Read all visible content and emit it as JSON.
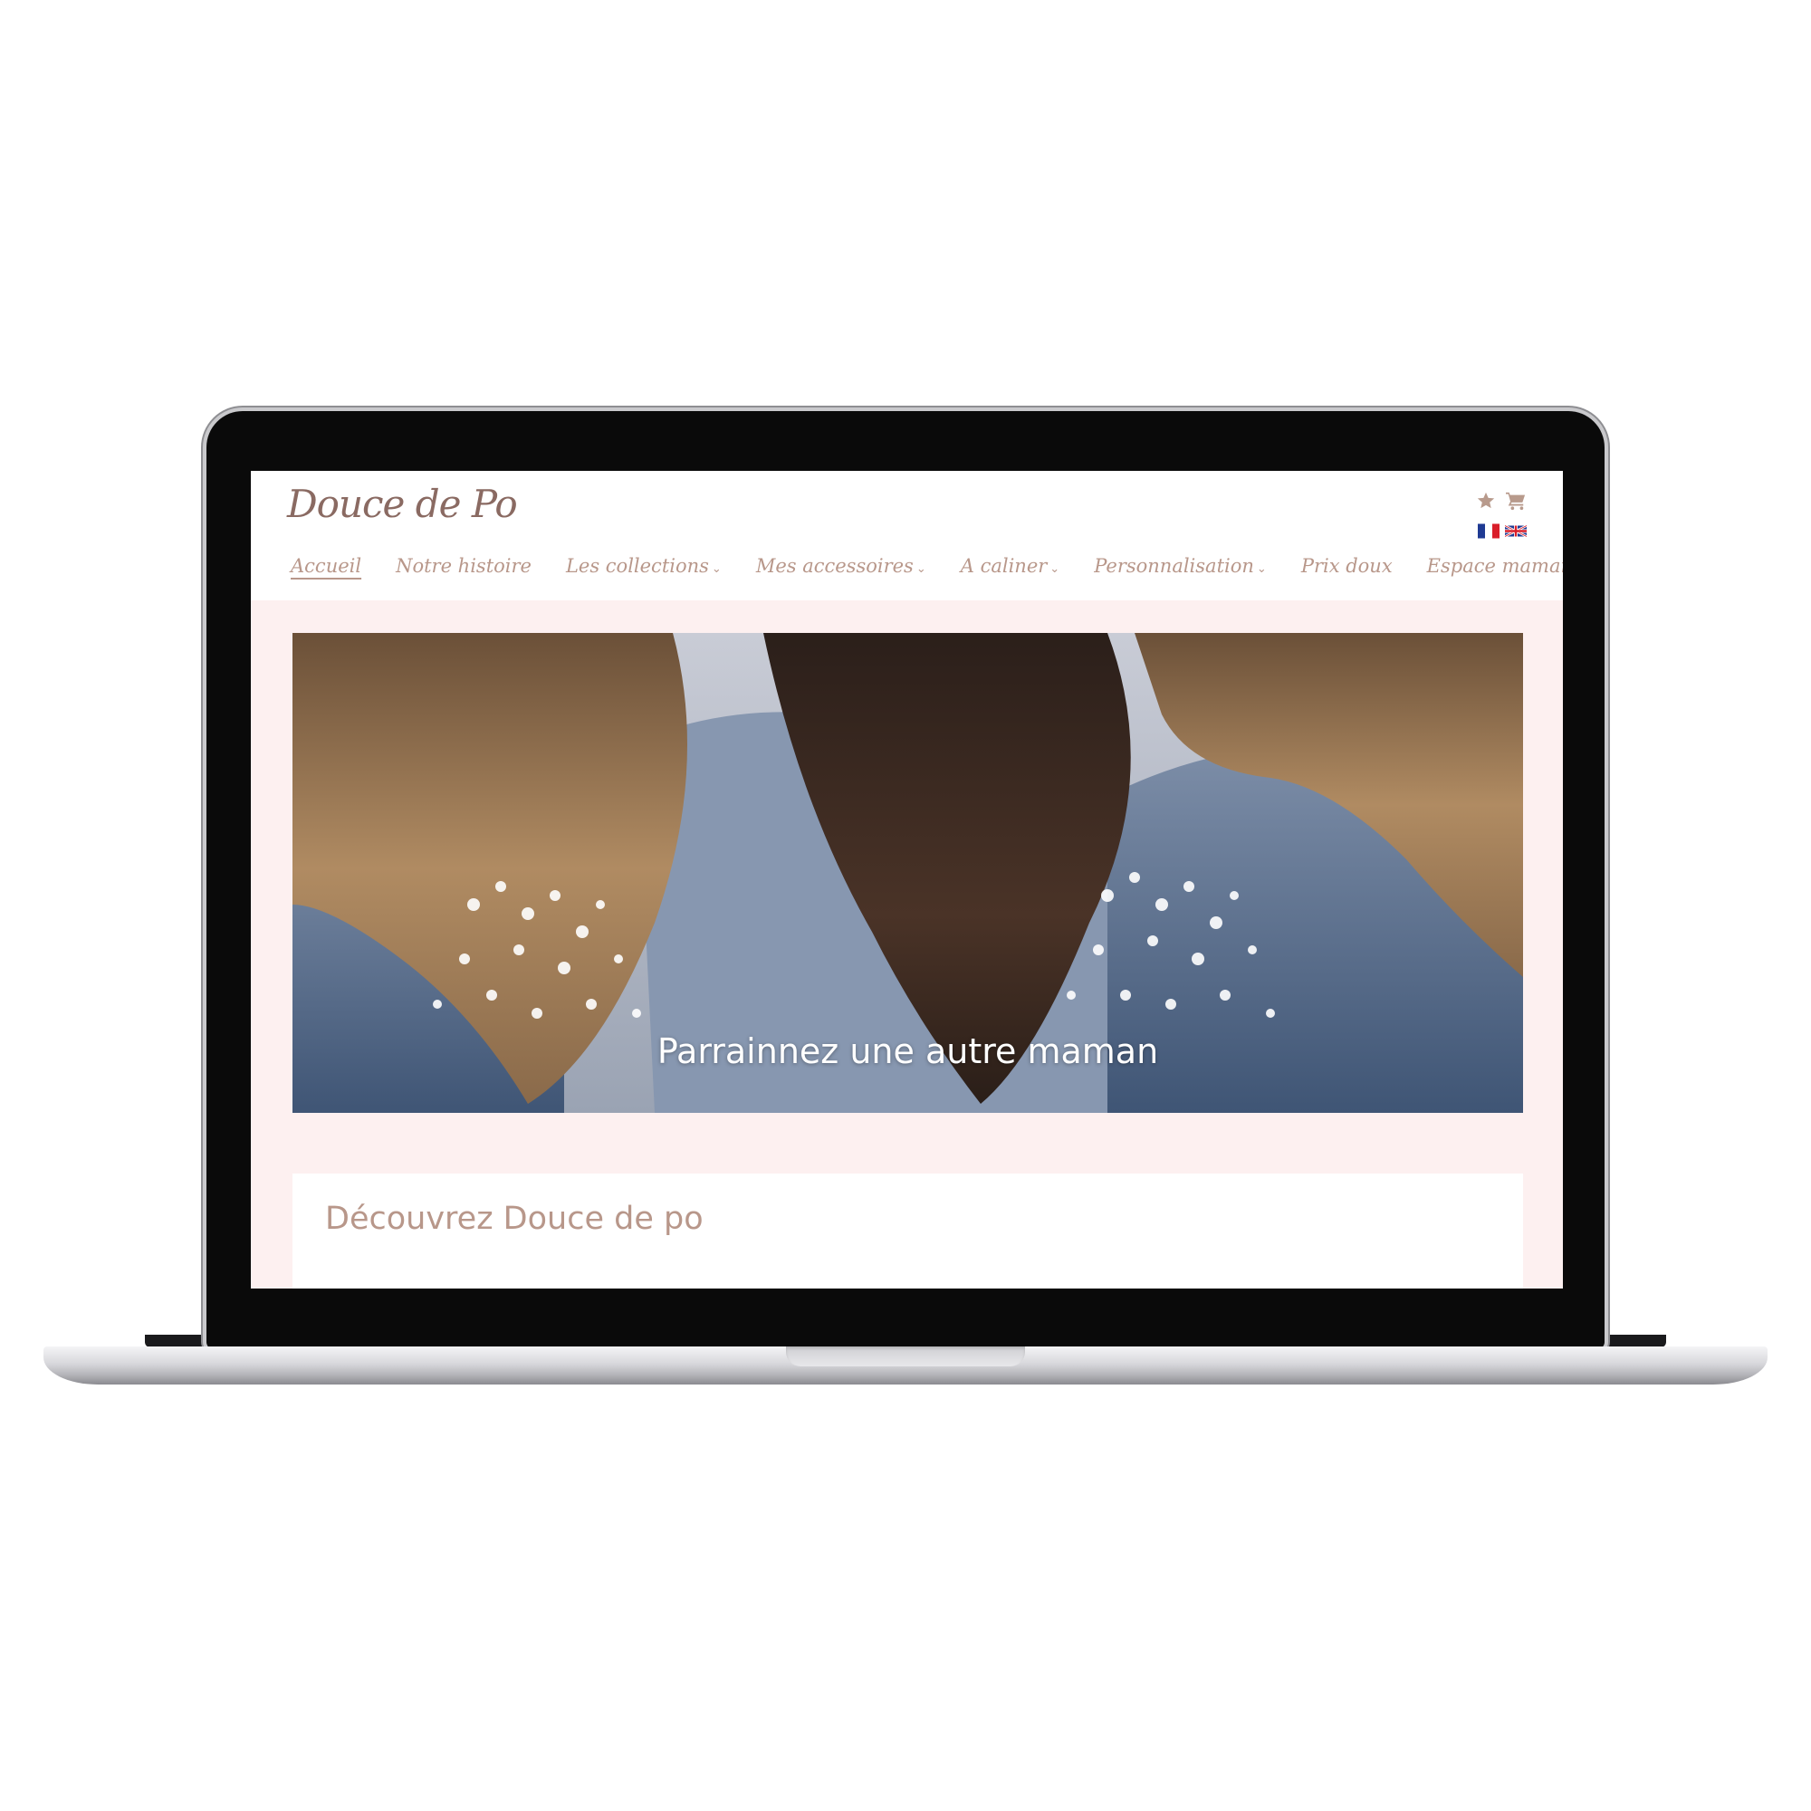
{
  "site": {
    "logo_text": "Douce de Po",
    "logo_heart": "♥"
  },
  "header_icons": {
    "favorites_icon": "star-icon",
    "cart_icon": "cart-icon"
  },
  "languages": [
    "fr",
    "en"
  ],
  "nav": {
    "items": [
      {
        "label": "Accueil",
        "active": true,
        "dropdown": false
      },
      {
        "label": "Notre histoire",
        "active": false,
        "dropdown": false
      },
      {
        "label": "Les collections",
        "active": false,
        "dropdown": true
      },
      {
        "label": "Mes accessoires",
        "active": false,
        "dropdown": true
      },
      {
        "label": "A caliner",
        "active": false,
        "dropdown": true
      },
      {
        "label": "Personnalisation",
        "active": false,
        "dropdown": true
      },
      {
        "label": "Prix doux",
        "active": false,
        "dropdown": false
      },
      {
        "label": "Espace maman",
        "active": false,
        "dropdown": false
      }
    ],
    "search_icon": "search-icon"
  },
  "hero": {
    "caption": "Parrainnez une autre maman"
  },
  "discover": {
    "title": "Découvrez Douce de po"
  },
  "colors": {
    "accent": "#b8978a",
    "page_background": "#fdf0f0",
    "logo_heart": "#e06a8a"
  }
}
